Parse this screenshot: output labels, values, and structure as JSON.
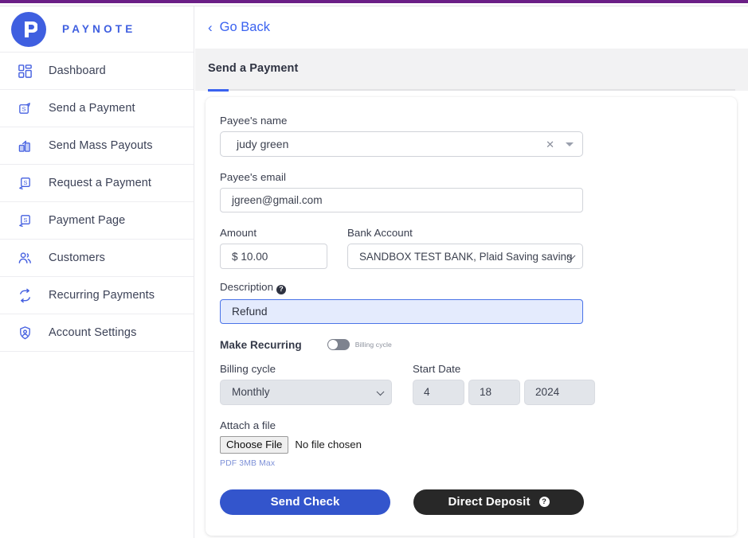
{
  "brand": {
    "name": "PAYNOTE",
    "logo_letter": "P",
    "logo_color": "#3f5fe0",
    "top_strip_color": "#6b1f86"
  },
  "sidebar": {
    "items": [
      {
        "label": "Dashboard",
        "icon": "dashboard-icon"
      },
      {
        "label": "Send a Payment",
        "icon": "send-payment-icon"
      },
      {
        "label": "Send Mass Payouts",
        "icon": "mass-payouts-icon"
      },
      {
        "label": "Request a Payment",
        "icon": "request-payment-icon"
      },
      {
        "label": "Payment Page",
        "icon": "payment-page-icon"
      },
      {
        "label": "Customers",
        "icon": "customers-icon"
      },
      {
        "label": "Recurring Payments",
        "icon": "recurring-payments-icon"
      },
      {
        "label": "Account Settings",
        "icon": "account-settings-icon"
      }
    ]
  },
  "header": {
    "go_back_label": "Go Back",
    "go_back_icon": "chevron-left-icon",
    "accent_color": "#3a62f0"
  },
  "tabs": {
    "active_label": "Send a Payment"
  },
  "form": {
    "payee_name": {
      "label": "Payee's name",
      "value": "judy green",
      "clear_icon": "close-x-icon",
      "dropdown_icon": "caret-down-icon"
    },
    "payee_email": {
      "label": "Payee's email",
      "value": "jgreen@gmail.com"
    },
    "amount": {
      "label": "Amount",
      "value": "$ 10.00"
    },
    "bank_account": {
      "label": "Bank Account",
      "value": "SANDBOX TEST BANK, Plaid Saving saving",
      "dropdown_icon": "chevron-down-icon"
    },
    "description": {
      "label": "Description",
      "help_icon": "question-mark-icon",
      "help_glyph": "?",
      "value": "Refund",
      "highlight_bg": "#e4ebfd",
      "highlight_border": "#4a73e8"
    },
    "make_recurring": {
      "label": "Make Recurring",
      "toggle_caption": "Billing cycle",
      "toggle_state": "off"
    },
    "billing_cycle": {
      "label": "Billing cycle",
      "value": "Monthly",
      "disabled": true,
      "dropdown_icon": "chevron-down-icon"
    },
    "start_date": {
      "label": "Start Date",
      "month": "4",
      "day": "18",
      "year": "2024",
      "disabled": true
    },
    "attach_file": {
      "label": "Attach a file",
      "button_label": "Choose File",
      "status": "No file chosen",
      "note": "PDF 3MB Max"
    }
  },
  "actions": {
    "send_check": {
      "label": "Send Check",
      "color": "#3355cc"
    },
    "direct_deposit": {
      "label": "Direct Deposit",
      "color": "#282828",
      "help_icon": "question-mark-icon",
      "help_glyph": "?"
    }
  }
}
